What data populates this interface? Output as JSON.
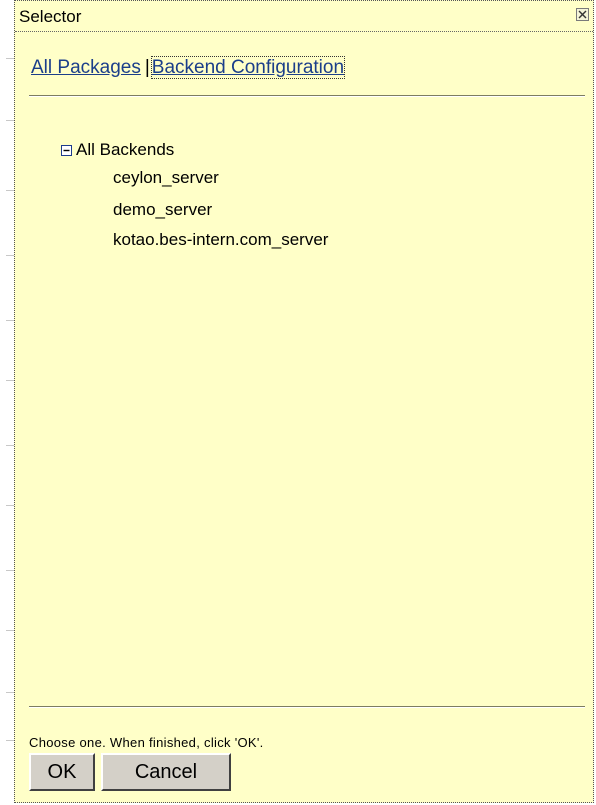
{
  "window": {
    "title": "Selector"
  },
  "tabs": [
    {
      "label": "All Packages",
      "active": false
    },
    {
      "label": "Backend Configuration",
      "active": true
    }
  ],
  "tab_separator": "|",
  "tree": {
    "root_label": "All Backends",
    "expanded": true,
    "children": [
      "ceylon_server",
      "demo_server",
      "kotao.bes-intern.com_server"
    ]
  },
  "footer": {
    "instruction": "Choose one. When finished, click 'OK'.",
    "ok_label": "OK",
    "cancel_label": "Cancel"
  },
  "colors": {
    "panel_background": "#ffffc8",
    "link": "#1b3e8a",
    "button_face": "#d4d0c8"
  },
  "icons": {
    "close": "close-icon",
    "collapse": "minus-box-icon"
  }
}
